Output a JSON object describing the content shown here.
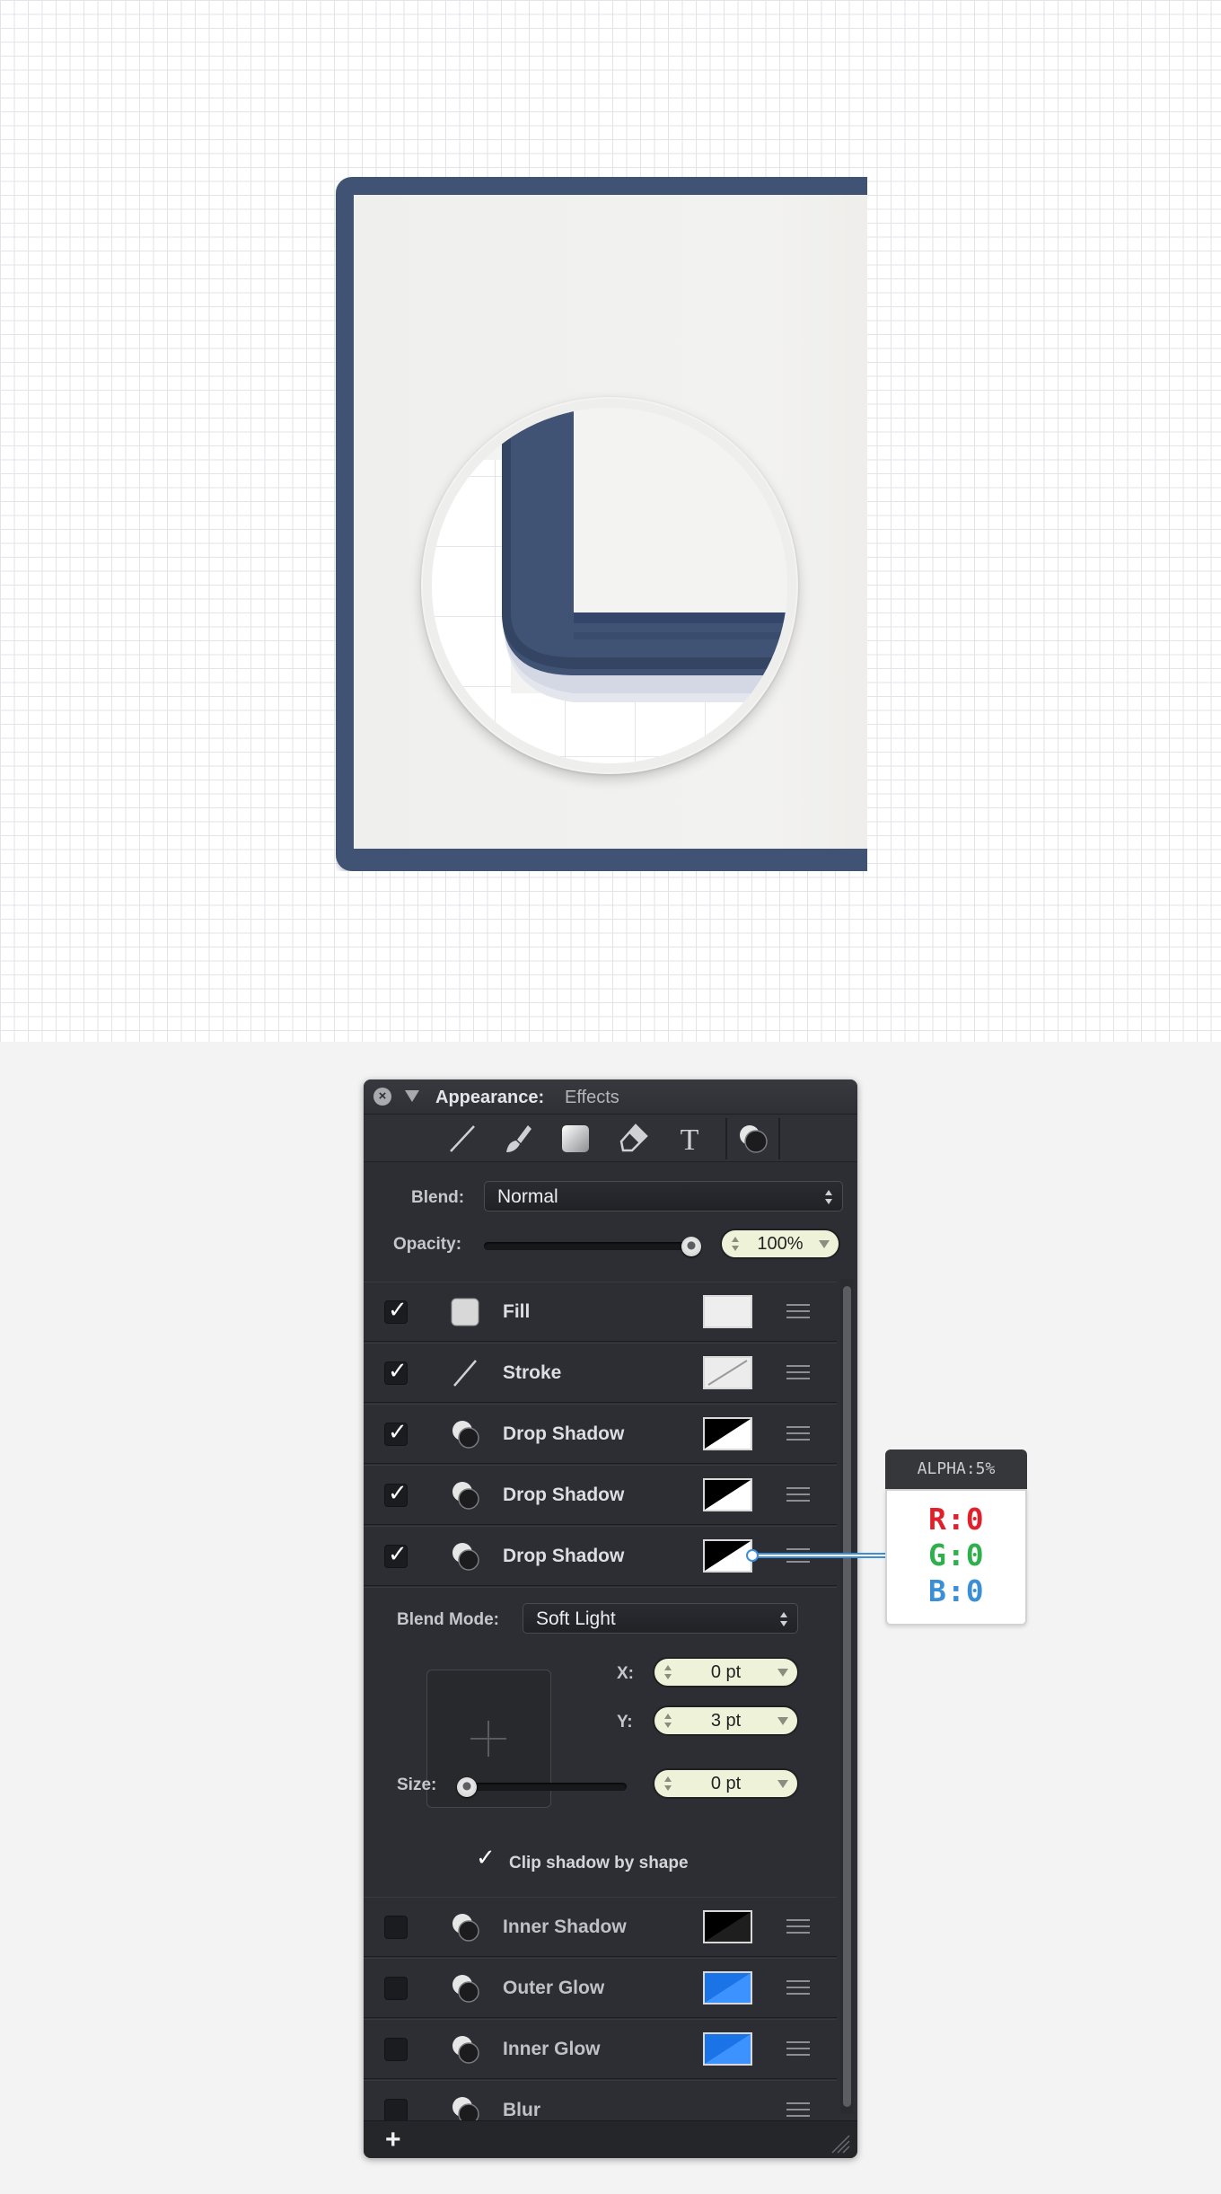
{
  "panel": {
    "title": "Appearance:",
    "subtitle": "Effects",
    "blend_label": "Blend:",
    "blend_value": "Normal",
    "opacity_label": "Opacity:",
    "opacity_value": "100%",
    "opacity_fraction": 1.0,
    "toolbar_icons": [
      "line-tool-icon",
      "brush-tool-icon",
      "fill-tool-icon",
      "pen-tool-icon",
      "text-tool-icon",
      "effects-tool-icon"
    ],
    "effects": [
      {
        "label": "Fill",
        "checked": true,
        "icon": "fill-icon",
        "swatch": "light"
      },
      {
        "label": "Stroke",
        "checked": true,
        "icon": "stroke-icon",
        "swatch": "slash"
      },
      {
        "label": "Drop Shadow",
        "checked": true,
        "icon": "shadow-icon",
        "swatch": "bw"
      },
      {
        "label": "Drop Shadow",
        "checked": true,
        "icon": "shadow-icon",
        "swatch": "bw"
      },
      {
        "label": "Drop Shadow",
        "checked": true,
        "icon": "shadow-icon",
        "swatch": "bw"
      }
    ],
    "detail": {
      "blend_mode_label": "Blend Mode:",
      "blend_mode_value": "Soft Light",
      "x_label": "X:",
      "x_value": "0 pt",
      "y_label": "Y:",
      "y_value": "3 pt",
      "size_label": "Size:",
      "size_value": "0 pt",
      "size_fraction": 0.0,
      "clip_label": "Clip shadow by shape",
      "clip_checked": true
    },
    "more_effects": [
      {
        "label": "Inner Shadow",
        "checked": false,
        "icon": "shadow-icon",
        "swatch": "black"
      },
      {
        "label": "Outer Glow",
        "checked": false,
        "icon": "shadow-icon",
        "swatch": "blue"
      },
      {
        "label": "Inner Glow",
        "checked": false,
        "icon": "shadow-icon",
        "swatch": "blue"
      },
      {
        "label": "Blur",
        "checked": false,
        "icon": "shadow-icon",
        "swatch": "none"
      }
    ],
    "add_label": "+"
  },
  "callout": {
    "alpha": "ALPHA:5%",
    "r": "R:0",
    "g": "G:0",
    "b": "B:0"
  },
  "colors": {
    "frame": "#405375",
    "panel_bg": "#2d2e33",
    "stepper_bg": "#eef2d9",
    "accent_blue": "#3b8fd8",
    "red": "#e0202a",
    "green": "#2fb04c",
    "blue": "#3a8fd6"
  }
}
